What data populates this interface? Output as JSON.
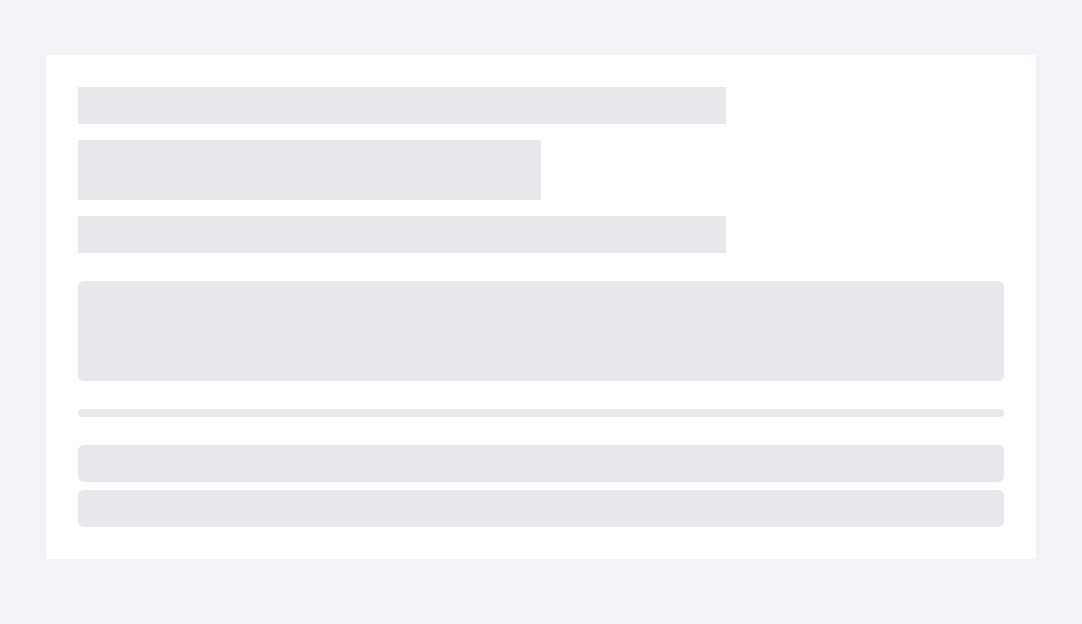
{
  "state": "loading",
  "colors": {
    "background": "#f2f3f7",
    "card": "#ffffff",
    "skeleton": "#e7e8ec"
  }
}
